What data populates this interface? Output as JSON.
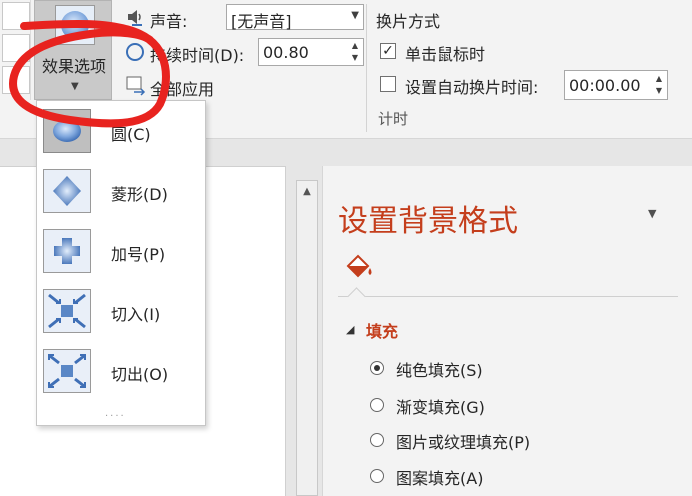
{
  "ribbon": {
    "effect_options_label": "效果选项",
    "sound_label": "声音:",
    "sound_value": "[无声音]",
    "duration_label": "持续时间(D):",
    "duration_value": "00.80",
    "apply_all_label": "全部应用",
    "switch_mode_title": "换片方式",
    "on_click_label": "单击鼠标时",
    "on_click_checked": true,
    "auto_after_label": "设置自动换片时间:",
    "auto_after_checked": false,
    "auto_after_value": "00:00.00",
    "timing_group_label": "计时"
  },
  "gallery": {
    "items": [
      {
        "label": "圆(C)",
        "icon": "circle-shape-icon",
        "selected": true
      },
      {
        "label": "菱形(D)",
        "icon": "diamond-shape-icon",
        "selected": false
      },
      {
        "label": "加号(P)",
        "icon": "plus-shape-icon",
        "selected": false
      },
      {
        "label": "切入(I)",
        "icon": "cut-in-icon",
        "selected": false
      },
      {
        "label": "切出(O)",
        "icon": "cut-out-icon",
        "selected": false
      }
    ]
  },
  "pane": {
    "title": "设置背景格式",
    "section_title": "填充",
    "options": [
      {
        "label": "纯色填充(S)",
        "selected": true
      },
      {
        "label": "渐变填充(G)",
        "selected": false
      },
      {
        "label": "图片或纹理填充(P)",
        "selected": false
      },
      {
        "label": "图案填充(A)",
        "selected": false
      }
    ]
  },
  "colors": {
    "accent_orange": "#c43e1c",
    "annotation_red": "#e8231f",
    "selection_gray": "#c9c9c9"
  }
}
